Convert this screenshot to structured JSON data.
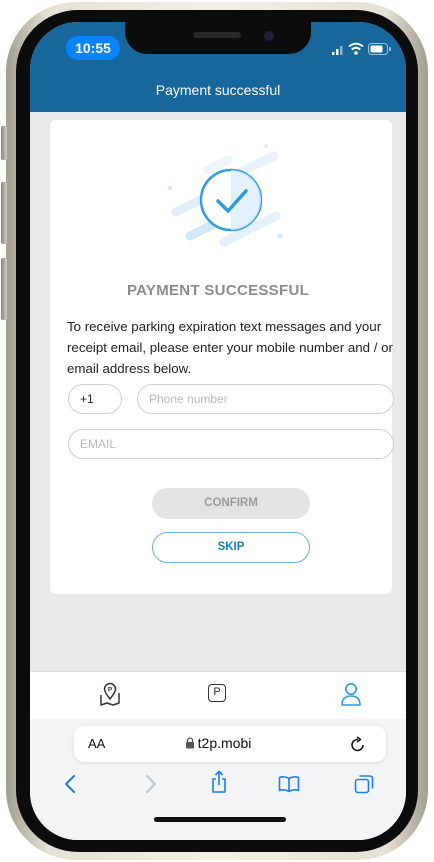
{
  "status_bar": {
    "time": "10:55"
  },
  "header": {
    "title": "Payment successful"
  },
  "main": {
    "title": "PAYMENT SUCCESSFUL",
    "instructions": "To receive parking expiration text messages and your receipt email, please enter your mobile number and / or email address below.",
    "country_code": "+1",
    "phone_placeholder": "Phone number",
    "email_placeholder": "EMAIL",
    "confirm_label": "CONFIRM",
    "skip_label": "SKIP"
  },
  "tab_bar": {
    "items": [
      {
        "icon": "map-pin-icon"
      },
      {
        "icon": "parking-icon",
        "label": "P"
      },
      {
        "icon": "user-icon",
        "active": true
      }
    ]
  },
  "browser": {
    "text_size_label": "AA",
    "url": "t2p.mobi",
    "toolbar": [
      "back-icon",
      "forward-icon",
      "share-icon",
      "bookmarks-icon",
      "tabs-icon"
    ]
  },
  "colors": {
    "header": "#18679c",
    "accent": "#1a7fc0",
    "time_pill": "#0a84ff"
  }
}
